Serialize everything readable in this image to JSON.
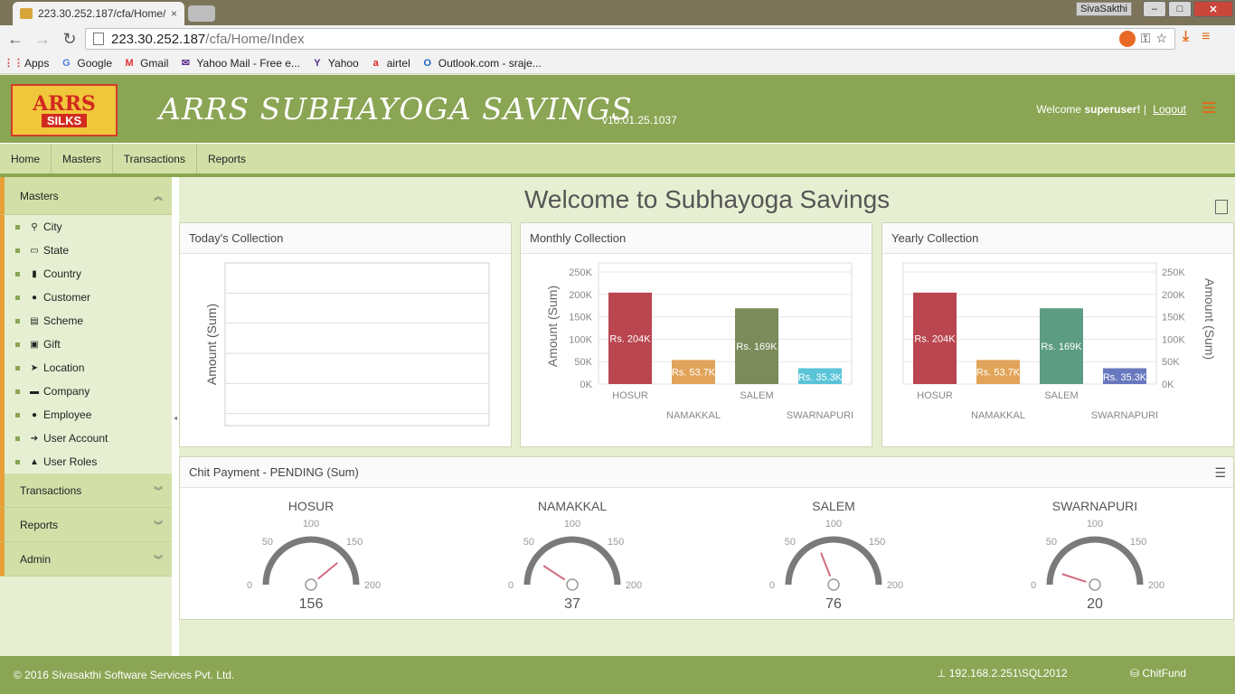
{
  "browser": {
    "tab_title": "223.30.252.187/cfa/Home/",
    "tab_close": "×",
    "window_user": "SivaSakthi",
    "url_host": "223.30.252.187",
    "url_path": "/cfa/Home/Index",
    "bookmarks": [
      {
        "label": "Apps",
        "icon": "apps-grid-icon"
      },
      {
        "label": "Google",
        "icon": "google-icon"
      },
      {
        "label": "Gmail",
        "icon": "gmail-icon"
      },
      {
        "label": "Yahoo Mail - Free e...",
        "icon": "mail-icon"
      },
      {
        "label": "Yahoo",
        "icon": "yahoo-icon"
      },
      {
        "label": "airtel",
        "icon": "airtel-icon"
      },
      {
        "label": "Outlook.com - sraje...",
        "icon": "outlook-icon"
      }
    ]
  },
  "header": {
    "logo_top": "ARRS",
    "logo_bottom": "SILKS",
    "title": "ARRS SUBHAYOGA SAVINGS",
    "version": "v16.01.25.1037",
    "welcome_prefix": "Welcome",
    "username": "superuser!",
    "separator": "|",
    "logout": "Logout"
  },
  "nav": [
    "Home",
    "Masters",
    "Transactions",
    "Reports"
  ],
  "sidebar": {
    "masters_label": "Masters",
    "items": [
      {
        "label": "City",
        "icon": "map-marker-icon",
        "glyph": "⚲"
      },
      {
        "label": "State",
        "icon": "map-icon",
        "glyph": "▭"
      },
      {
        "label": "Country",
        "icon": "map-filled-icon",
        "glyph": "▮"
      },
      {
        "label": "Customer",
        "icon": "user-icon",
        "glyph": "●"
      },
      {
        "label": "Scheme",
        "icon": "book-icon",
        "glyph": "▤"
      },
      {
        "label": "Gift",
        "icon": "gift-icon",
        "glyph": "▣"
      },
      {
        "label": "Location",
        "icon": "location-arrow-icon",
        "glyph": "➤"
      },
      {
        "label": "Company",
        "icon": "briefcase-icon",
        "glyph": "▬"
      },
      {
        "label": "Employee",
        "icon": "users-icon",
        "glyph": "●"
      },
      {
        "label": "User Account",
        "icon": "sign-in-icon",
        "glyph": "➔"
      },
      {
        "label": "User Roles",
        "icon": "lock-icon",
        "glyph": "▲"
      }
    ],
    "sections": [
      "Transactions",
      "Reports",
      "Admin"
    ]
  },
  "main": {
    "title": "Welcome to Subhayoga Savings",
    "today_title": "Today's Collection",
    "monthly_title": "Monthly Collection",
    "yearly_title": "Yearly Collection",
    "pending_title": "Chit Payment - PENDING (Sum)"
  },
  "chart_data": [
    {
      "type": "bar",
      "title": "Today's Collection",
      "ylabel": "Amount (Sum)",
      "categories": [],
      "values": []
    },
    {
      "type": "bar",
      "title": "Monthly Collection",
      "ylabel": "Amount (Sum)",
      "categories": [
        "HOSUR",
        "NAMAKKAL",
        "SALEM",
        "SWARNAPURI"
      ],
      "values": [
        204000,
        53700,
        169000,
        35300
      ],
      "data_labels": [
        "Rs. 204K",
        "Rs. 53.7K",
        "Rs. 169K",
        "Rs. 35.3K"
      ],
      "colors": [
        "#b9454f",
        "#e2a45a",
        "#7b8b5a",
        "#5ac4d8"
      ],
      "yticks": [
        "0K",
        "50K",
        "100K",
        "150K",
        "200K",
        "250K"
      ],
      "ylim": [
        0,
        250000
      ],
      "axis_side": "left"
    },
    {
      "type": "bar",
      "title": "Yearly Collection",
      "ylabel": "Amount (Sum)",
      "categories": [
        "HOSUR",
        "NAMAKKAL",
        "SALEM",
        "SWARNAPURI"
      ],
      "values": [
        204000,
        53700,
        169000,
        35300
      ],
      "data_labels": [
        "Rs. 204K",
        "Rs. 53.7K",
        "Rs. 169K",
        "Rs. 35.3K"
      ],
      "colors": [
        "#b9454f",
        "#e2a45a",
        "#5c9c82",
        "#6878be"
      ],
      "yticks": [
        "0K",
        "50K",
        "100K",
        "150K",
        "200K",
        "250K"
      ],
      "ylim": [
        0,
        250000
      ],
      "axis_side": "right"
    },
    {
      "type": "gauge",
      "title": "Chit Payment - PENDING (Sum)",
      "range": [
        0,
        200
      ],
      "tick_labels": [
        "0",
        "50",
        "100",
        "150",
        "200"
      ],
      "gauges": [
        {
          "name": "HOSUR",
          "value": 156
        },
        {
          "name": "NAMAKKAL",
          "value": 37
        },
        {
          "name": "SALEM",
          "value": 76
        },
        {
          "name": "SWARNAPURI",
          "value": 20
        }
      ]
    }
  ],
  "footer": {
    "copyright": "© 2016 Sivasakthi Software Services Pvt. Ltd.",
    "server": "192.168.2.251\\SQL2012",
    "database": "ChitFund"
  }
}
